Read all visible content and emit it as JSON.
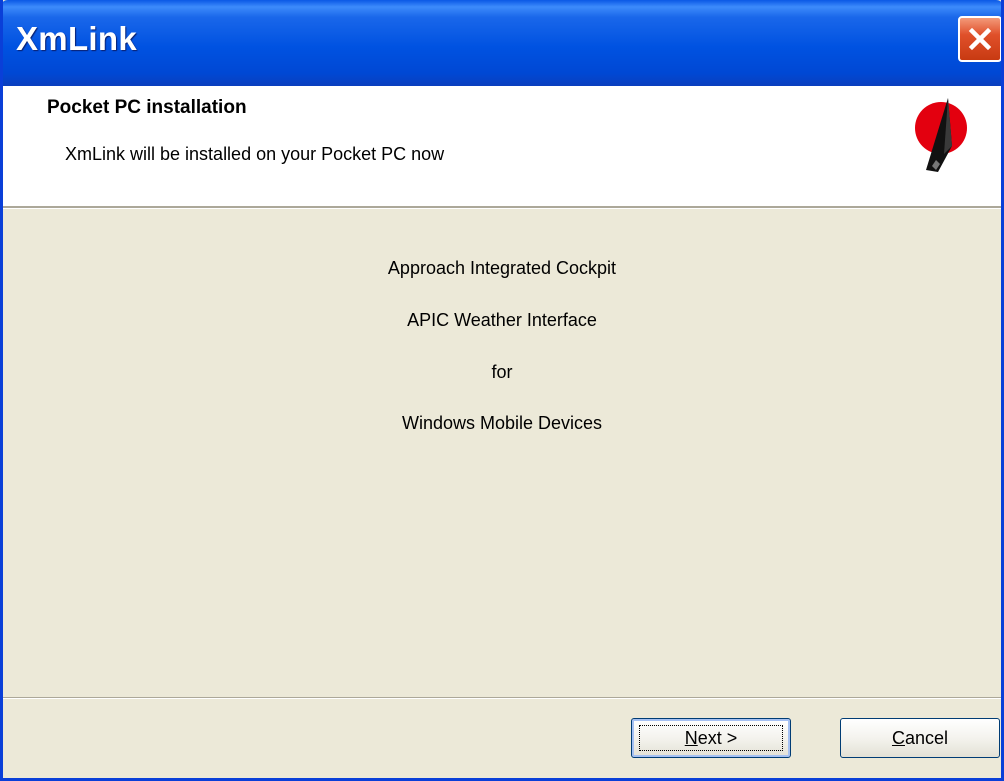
{
  "window": {
    "title": "XmLink"
  },
  "header": {
    "title": "Pocket PC installation",
    "subtitle": "XmLink will be installed on your Pocket PC now"
  },
  "body": {
    "lines": [
      "Approach Integrated Cockpit",
      "APIC Weather Interface",
      "for",
      "Windows Mobile Devices"
    ]
  },
  "buttons": {
    "next": {
      "mnemonic": "N",
      "rest": "ext >"
    },
    "cancel": {
      "mnemonic": "C",
      "rest": "ancel"
    }
  },
  "icons": {
    "close": "close-icon",
    "logo": "apic-logo-icon"
  },
  "colors": {
    "titlebar": "#0052e1",
    "close_button": "#e0502a",
    "dialog_background": "#ece9d8",
    "header_background": "#ffffff",
    "logo_red": "#e3000f"
  }
}
